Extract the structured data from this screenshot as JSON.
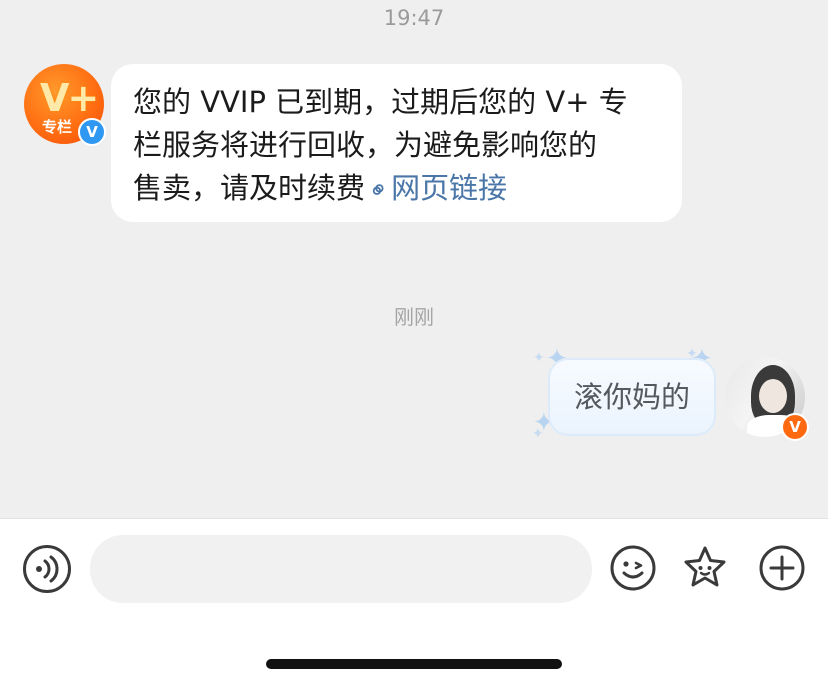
{
  "chat": {
    "time_top": "19:47",
    "time_bottom": "刚刚",
    "incoming": {
      "avatar_text": "V+",
      "avatar_sub": "专栏",
      "badge": "V",
      "line1": "您的 VVIP 已到期，过期后您的 V+ 专",
      "line2": "栏服务将进行回收，为避免影响您的",
      "line3": "售卖，请及时续费",
      "link_icon": "link-icon",
      "link_text": "网页链接"
    },
    "outgoing": {
      "text": "滚你妈的",
      "badge": "V"
    }
  },
  "input_bar": {
    "voice_icon": "voice-icon",
    "input_value": "",
    "emoji_icon": "emoji-icon",
    "sticker_icon": "sticker-star-icon",
    "plus_icon": "plus-icon"
  },
  "colors": {
    "chat_bg": "#efefef",
    "link": "#4a76a8",
    "badge_blue": "#2e98f2",
    "badge_orange": "#ff6a10"
  }
}
